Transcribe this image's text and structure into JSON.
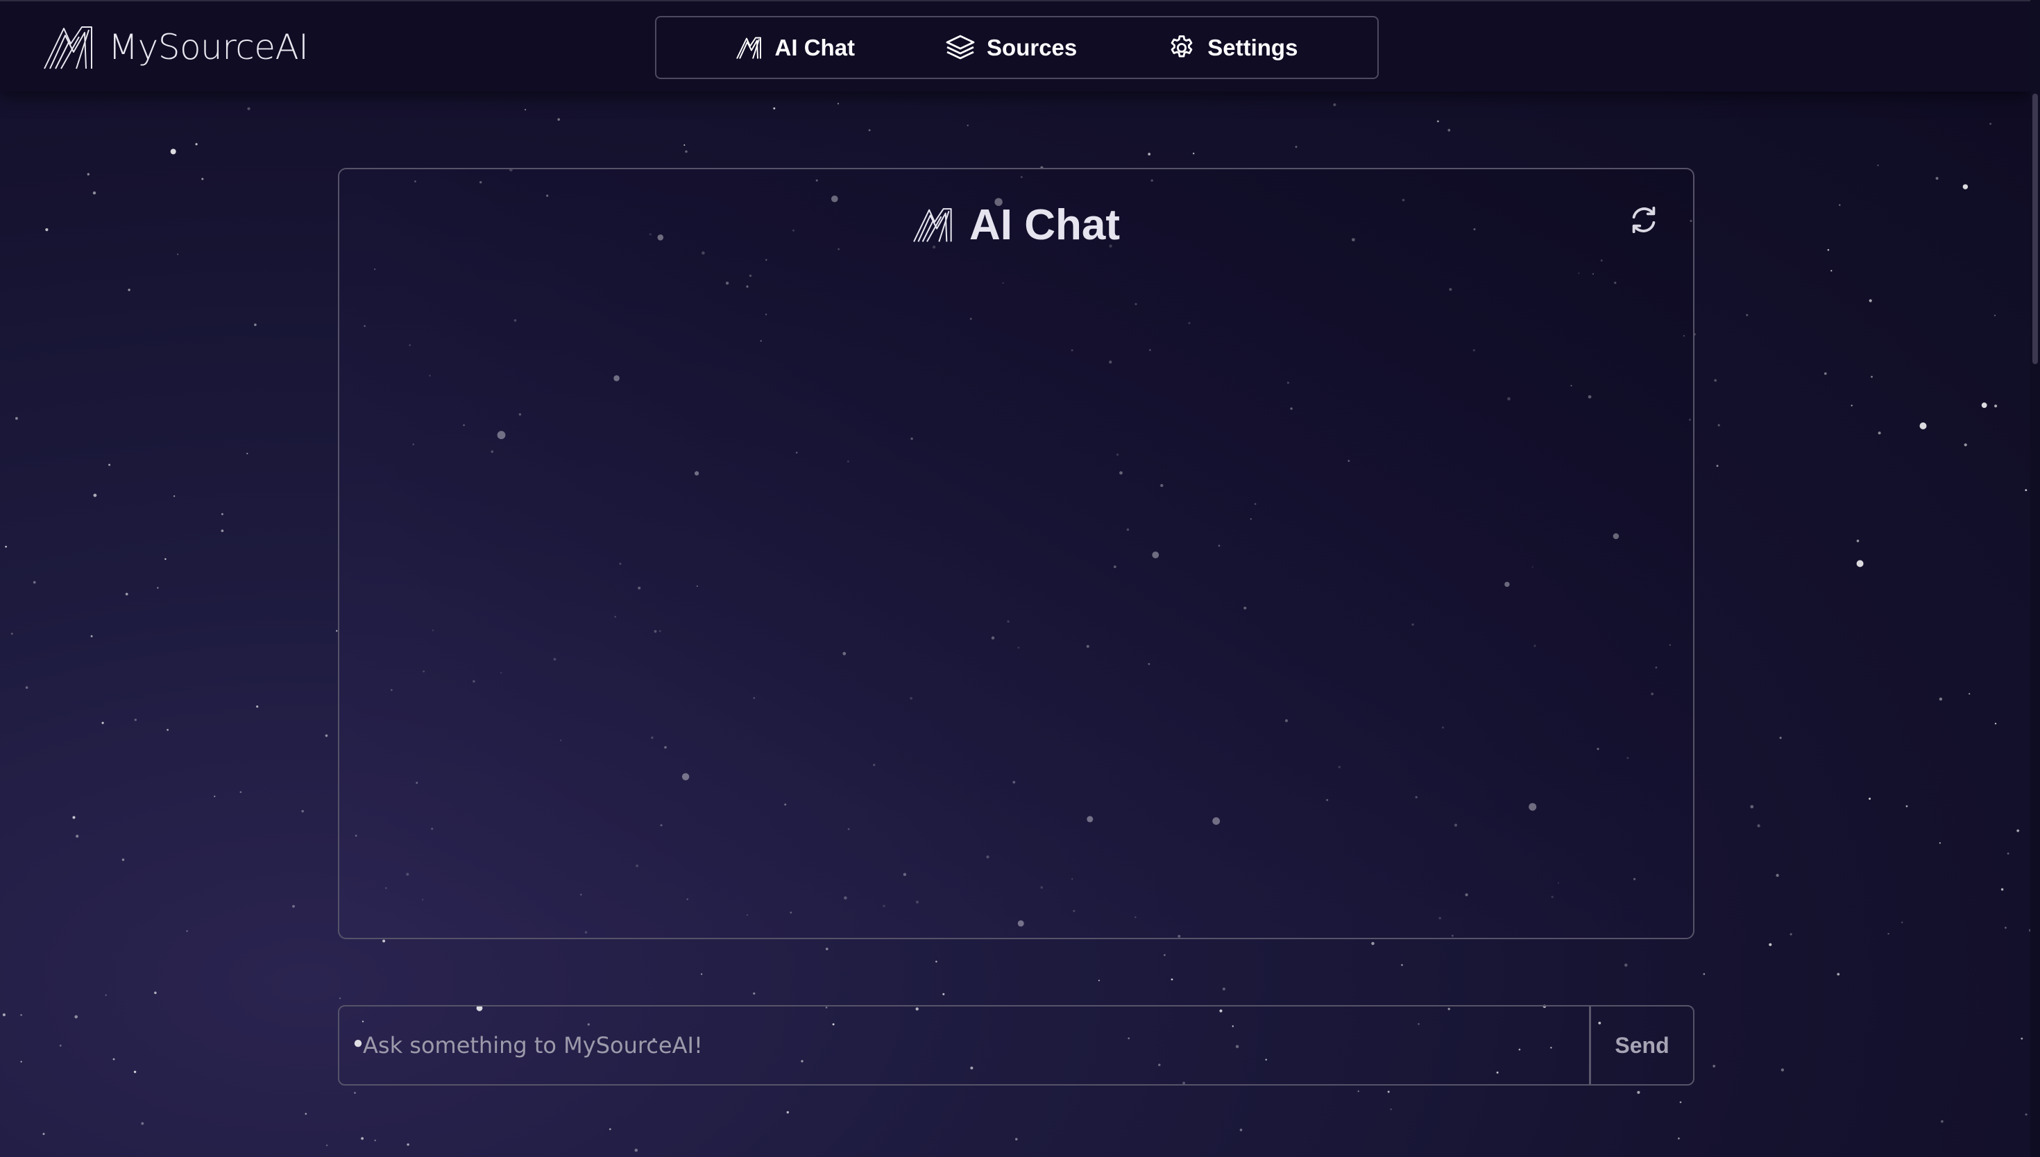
{
  "app": {
    "brand_name": "MySourceAI"
  },
  "nav": {
    "items": [
      {
        "label": "AI Chat",
        "icon": "logo-icon"
      },
      {
        "label": "Sources",
        "icon": "layers-icon"
      },
      {
        "label": "Settings",
        "icon": "gear-icon"
      }
    ]
  },
  "chat": {
    "title": "AI Chat",
    "refresh_icon": "refresh-icon"
  },
  "composer": {
    "placeholder": "Ask something to MySourceAI!",
    "value": "",
    "send_label": "Send"
  },
  "colors": {
    "background": "#15122f",
    "topbar": "#0f0c24",
    "border": "#565369",
    "text": "#ffffff",
    "muted_text": "#9d9aab"
  }
}
